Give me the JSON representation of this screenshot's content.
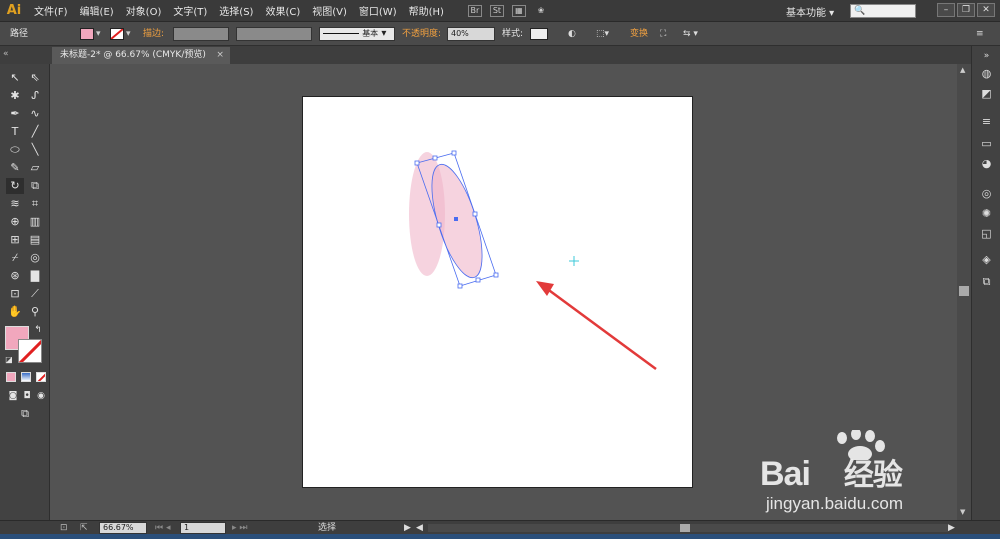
{
  "app": {
    "logo": "Ai",
    "workspace": "基本功能"
  },
  "menu": [
    "文件(F)",
    "编辑(E)",
    "对象(O)",
    "文字(T)",
    "选择(S)",
    "效果(C)",
    "视图(V)",
    "窗口(W)",
    "帮助(H)"
  ],
  "menubar_icons": {
    "bridge": "Br",
    "stock": "St"
  },
  "control": {
    "object_type": "路径",
    "stroke_label": "描边",
    "stroke_style": "基本",
    "opacity_label": "不透明度",
    "opacity_value": "40%",
    "style_label": "样式",
    "transform_label": "变换"
  },
  "document": {
    "tab_title": "未标题-2* @ 66.67% (CMYK/预览)",
    "close": "×"
  },
  "status": {
    "zoom": "66.67%",
    "artboard_num": "1",
    "tool_state": "选择"
  },
  "watermark": {
    "brand": "Bai",
    "brand_cn": "经验",
    "url": "jingyan.baidu.com"
  },
  "colors": {
    "fill": "#f1a7bd",
    "ellipse_fill": "#f0b6c9",
    "selection": "#4a6cf0",
    "arrow": "#e23a3a"
  }
}
